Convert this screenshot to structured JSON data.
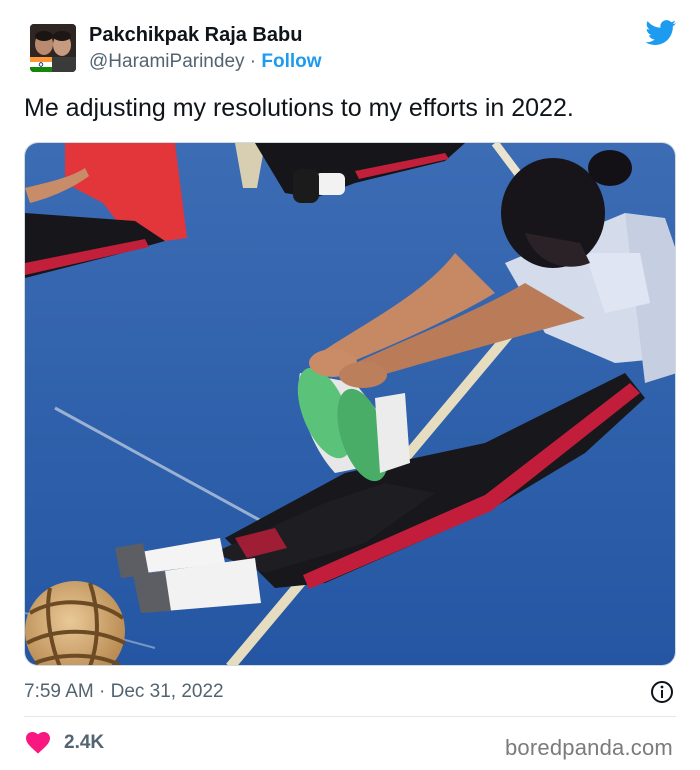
{
  "author": {
    "display_name": "Pakchikpak Raja Babu",
    "handle": "@HaramiParindey",
    "separator": "·",
    "follow_label": "Follow"
  },
  "tweet": {
    "text": "Me adjusting my resolutions to my efforts in 2022.",
    "timestamp": "7:59 AM · Dec 31, 2022"
  },
  "engagement": {
    "likes": "2.4K"
  },
  "icons": {
    "brand": "twitter-bird-icon",
    "info": "info-icon",
    "like": "heart-icon"
  },
  "watermark": "boredpanda.com",
  "colors": {
    "accent": "#1d9bf0",
    "heart": "#f91880",
    "secondary_text": "#536471",
    "floor": "#2a5fa8"
  }
}
